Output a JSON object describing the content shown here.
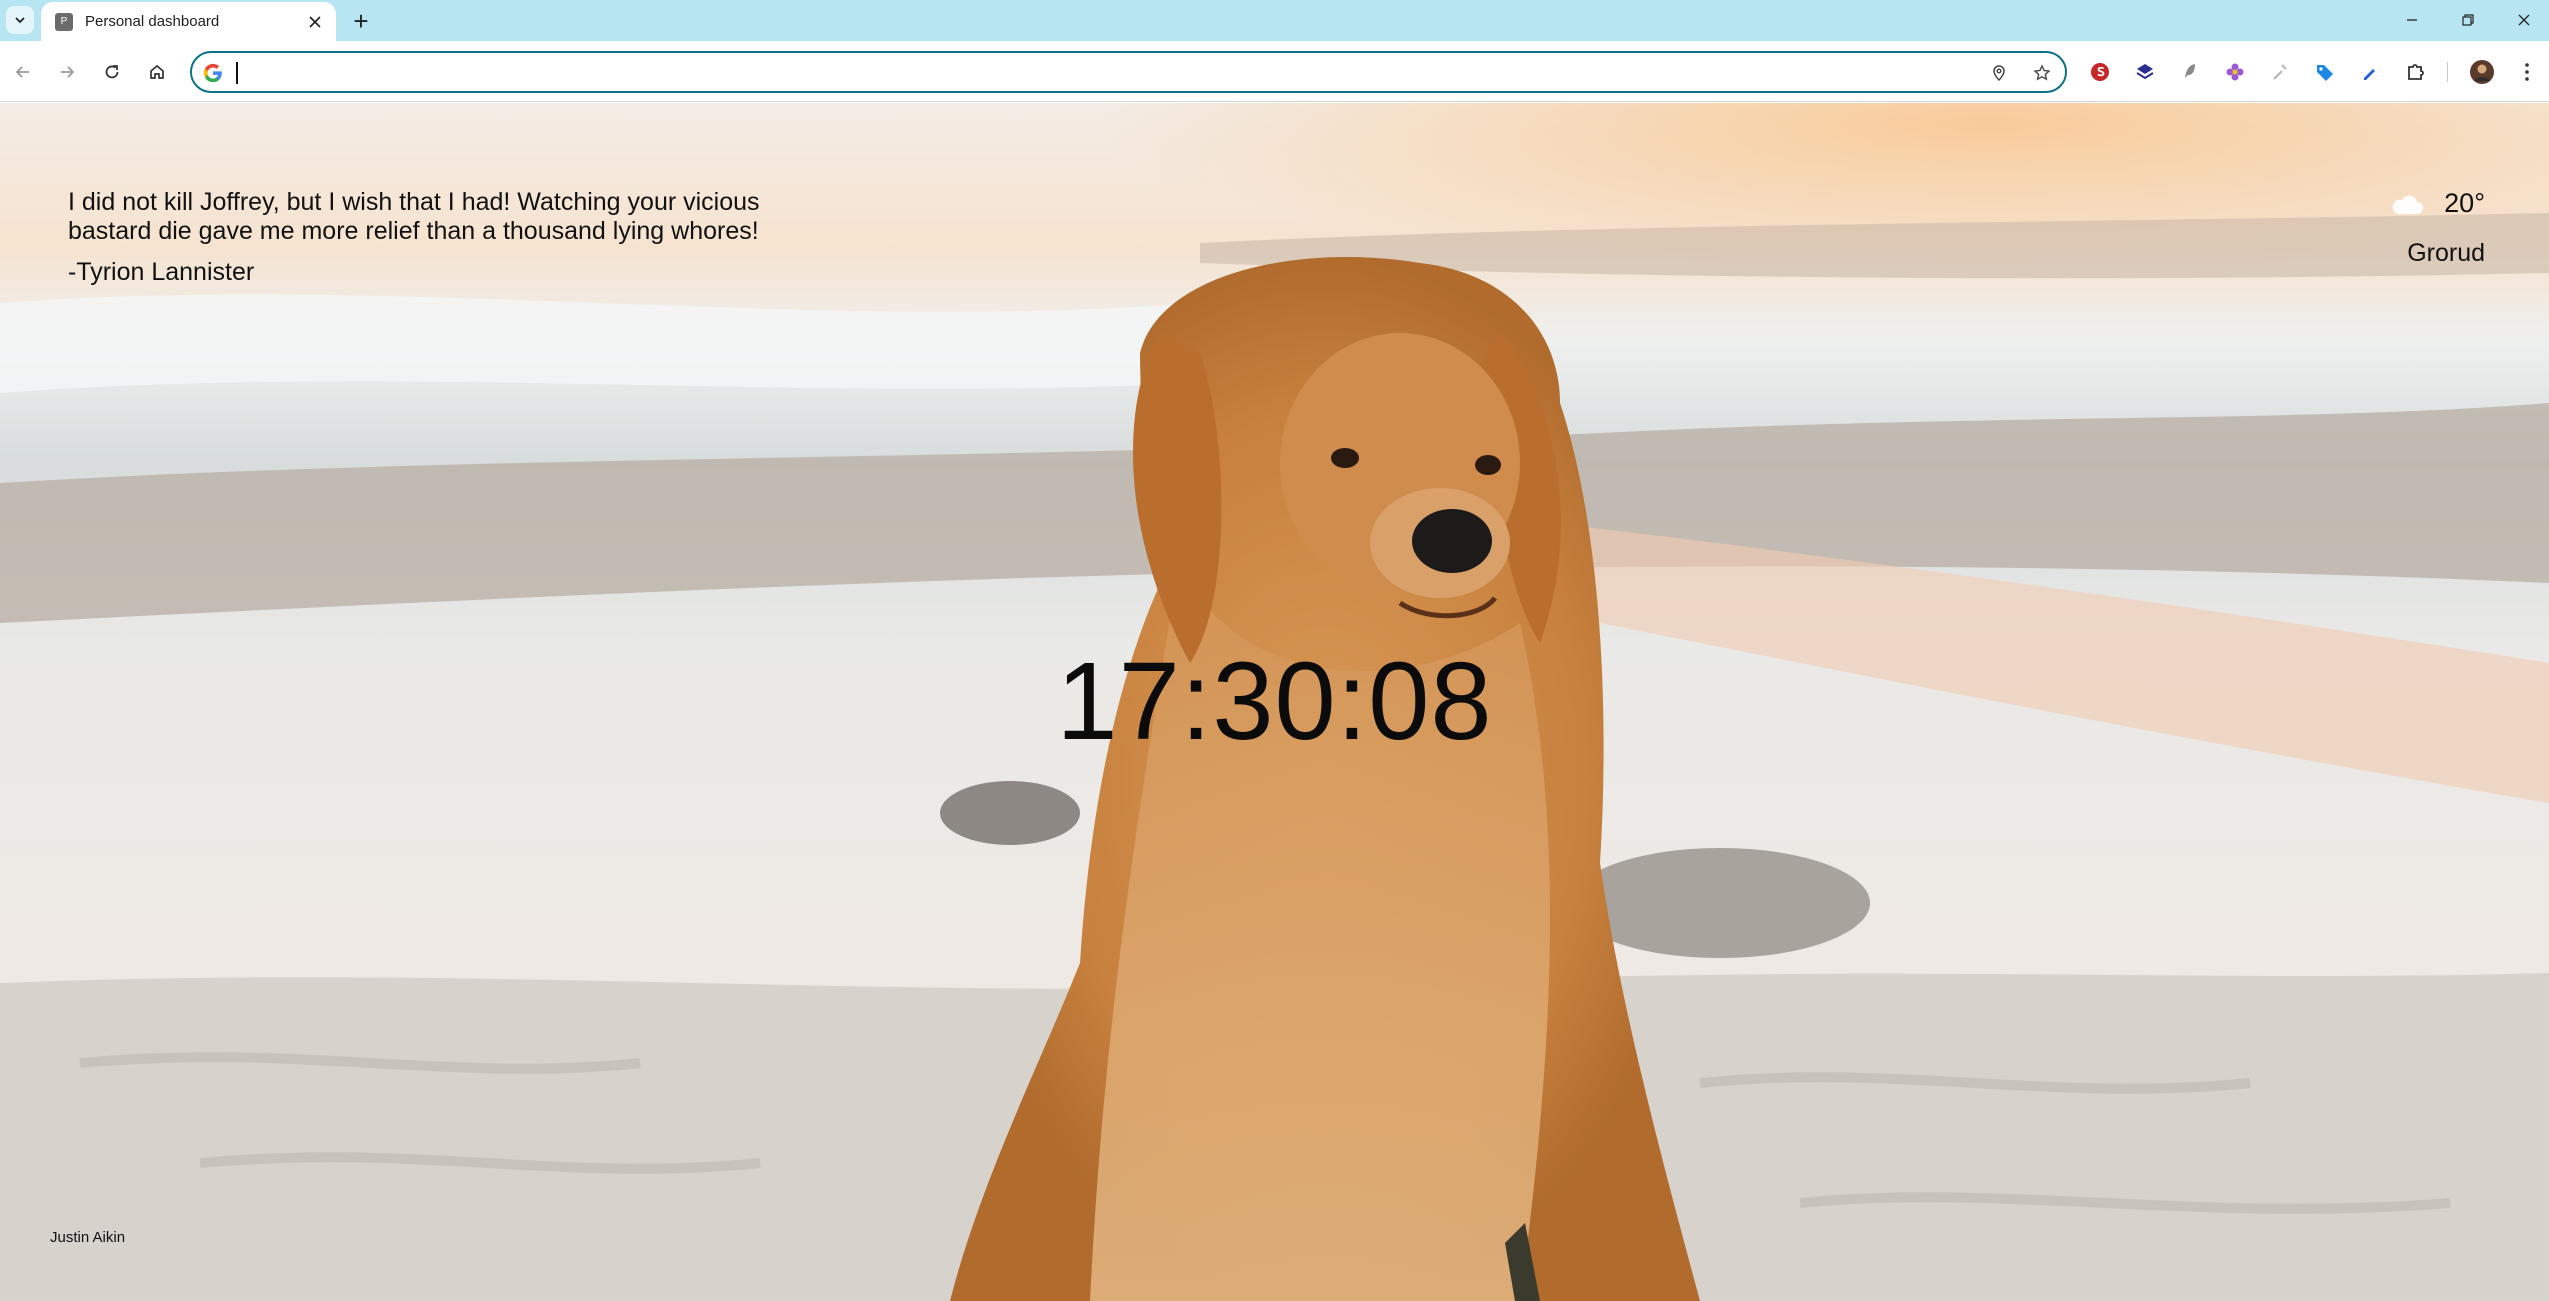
{
  "browser": {
    "tab": {
      "title": "Personal dashboard",
      "favicon_letter": "P"
    },
    "new_tab_label": "+",
    "omnibox": {
      "value": "",
      "placeholder": ""
    },
    "extensions": [
      "extension-s-icon",
      "extension-layers-icon",
      "extension-feather-icon",
      "extension-flower-icon",
      "extension-tool-icon",
      "extension-tag-icon",
      "extension-pen-icon"
    ]
  },
  "dashboard": {
    "quote": {
      "text": "I did not kill Joffrey, but I wish that I had! Watching your vicious bastard die gave me more relief than a thousand lying whores!",
      "author": "-Tyrion Lannister"
    },
    "weather": {
      "temperature": "20°",
      "city": "Grorud",
      "icon": "cloud-icon"
    },
    "clock": "17:30:08",
    "photo_credit": "Justin Aikin"
  },
  "colors": {
    "tabstrip": "#b7e6f2",
    "omnibox_border": "#0b7285"
  }
}
